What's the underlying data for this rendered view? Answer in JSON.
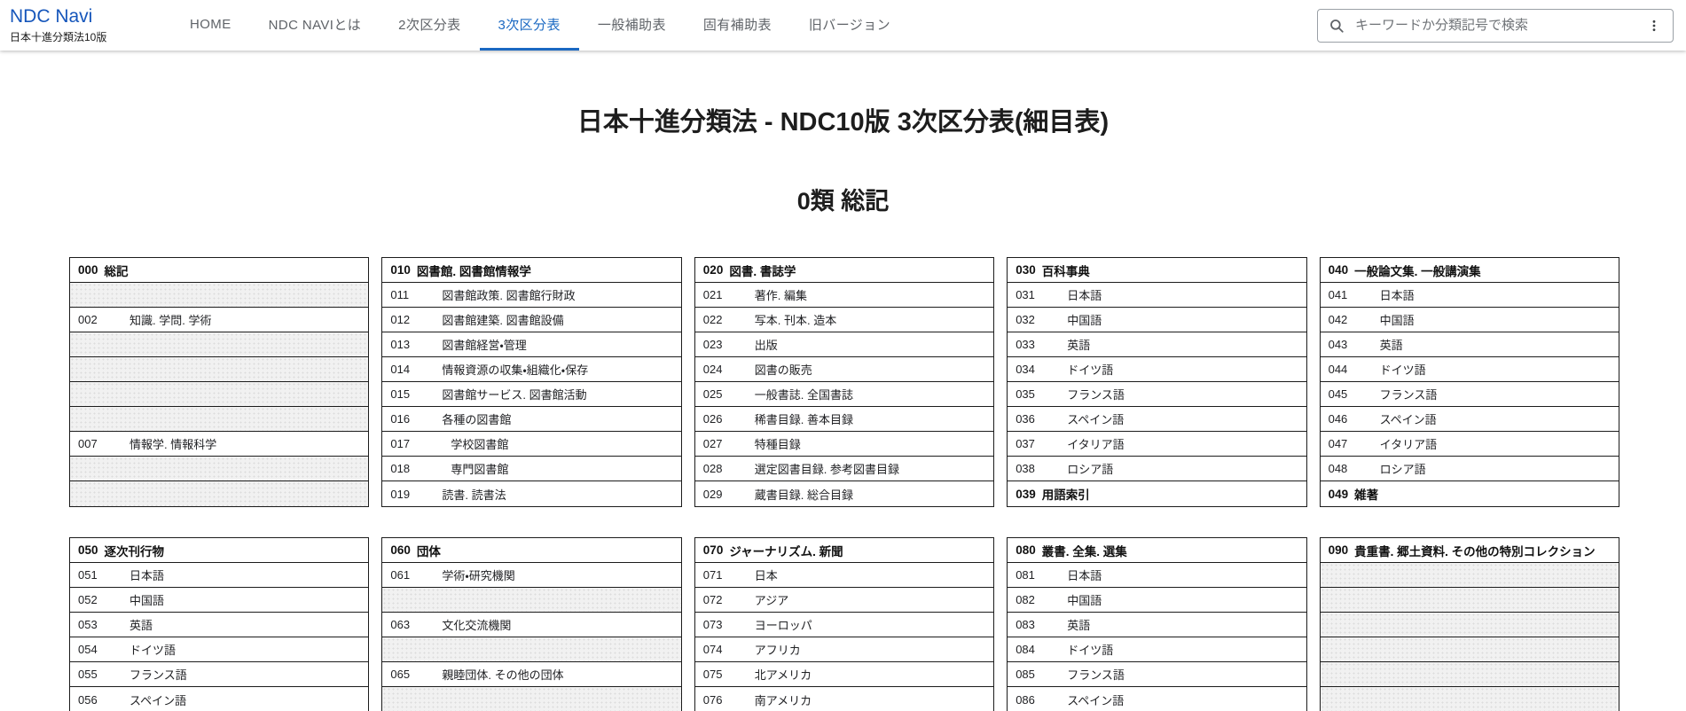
{
  "brand": {
    "title": "NDC Navi",
    "subtitle": "日本十進分類法10版"
  },
  "nav": {
    "items": [
      {
        "label": "HOME",
        "active": false
      },
      {
        "label": "NDC NAVIとは",
        "active": false
      },
      {
        "label": "2次区分表",
        "active": false
      },
      {
        "label": "3次区分表",
        "active": true
      },
      {
        "label": "一般補助表",
        "active": false
      },
      {
        "label": "固有補助表",
        "active": false
      },
      {
        "label": "旧バージョン",
        "active": false
      }
    ]
  },
  "search": {
    "placeholder": "キーワードか分類記号で検索",
    "value": "",
    "magnifier_icon": "search-icon",
    "menu_icon": "kebab-menu-icon"
  },
  "page": {
    "title": "日本十進分類法 - NDC10版 3次区分表(細目表)",
    "section_heading": "0類 総記"
  },
  "colors": {
    "brand_blue": "#1656bb",
    "active_tab_blue": "#1a68c2",
    "nav_gray": "#5f6368",
    "table_border": "#1c1c1c",
    "empty_row_bg": "#f1f1f1"
  },
  "sections": [
    {
      "tables": [
        {
          "code": "000",
          "title": "総記",
          "rows": [
            {
              "empty": true
            },
            {
              "code": "002",
              "label": "知識. 学問. 学術"
            },
            {
              "empty": true
            },
            {
              "empty": true
            },
            {
              "empty": true
            },
            {
              "empty": true
            },
            {
              "code": "007",
              "label": "情報学. 情報科学"
            },
            {
              "empty": true
            },
            {
              "empty": true
            }
          ]
        },
        {
          "code": "010",
          "title": "図書館. 図書館情報学",
          "rows": [
            {
              "code": "011",
              "label": "図書館政策. 図書館行財政"
            },
            {
              "code": "012",
              "label": "図書館建築. 図書館設備"
            },
            {
              "code": "013",
              "label": "図書館経営・管理"
            },
            {
              "code": "014",
              "label": "情報資源の収集・組織化・保存"
            },
            {
              "code": "015",
              "label": "図書館サービス. 図書館活動"
            },
            {
              "code": "016",
              "label": "各種の図書館"
            },
            {
              "code": "017",
              "label": "学校図書館",
              "indent": true
            },
            {
              "code": "018",
              "label": "専門図書館",
              "indent": true
            },
            {
              "code": "019",
              "label": "読書. 読書法"
            }
          ]
        },
        {
          "code": "020",
          "title": "図書. 書誌学",
          "rows": [
            {
              "code": "021",
              "label": "著作. 編集"
            },
            {
              "code": "022",
              "label": "写本. 刊本. 造本"
            },
            {
              "code": "023",
              "label": "出版"
            },
            {
              "code": "024",
              "label": "図書の販売"
            },
            {
              "code": "025",
              "label": "一般書誌. 全国書誌"
            },
            {
              "code": "026",
              "label": "稀書目録. 善本目録"
            },
            {
              "code": "027",
              "label": "特種目録"
            },
            {
              "code": "028",
              "label": "選定図書目録. 参考図書目録"
            },
            {
              "code": "029",
              "label": "蔵書目録. 総合目録"
            }
          ]
        },
        {
          "code": "030",
          "title": "百科事典",
          "rows": [
            {
              "code": "031",
              "label": "日本語"
            },
            {
              "code": "032",
              "label": "中国語"
            },
            {
              "code": "033",
              "label": "英語"
            },
            {
              "code": "034",
              "label": "ドイツ語"
            },
            {
              "code": "035",
              "label": "フランス語"
            },
            {
              "code": "036",
              "label": "スペイン語"
            },
            {
              "code": "037",
              "label": "イタリア語"
            },
            {
              "code": "038",
              "label": "ロシア語"
            },
            {
              "code": "039",
              "label": "用語索引",
              "bold": true
            }
          ]
        },
        {
          "code": "040",
          "title": "一般論文集. 一般講演集",
          "rows": [
            {
              "code": "041",
              "label": "日本語"
            },
            {
              "code": "042",
              "label": "中国語"
            },
            {
              "code": "043",
              "label": "英語"
            },
            {
              "code": "044",
              "label": "ドイツ語"
            },
            {
              "code": "045",
              "label": "フランス語"
            },
            {
              "code": "046",
              "label": "スペイン語"
            },
            {
              "code": "047",
              "label": "イタリア語"
            },
            {
              "code": "048",
              "label": "ロシア語"
            },
            {
              "code": "049",
              "label": "雑著",
              "bold": true
            }
          ]
        }
      ]
    },
    {
      "tables": [
        {
          "code": "050",
          "title": "逐次刊行物",
          "rows": [
            {
              "code": "051",
              "label": "日本語"
            },
            {
              "code": "052",
              "label": "中国語"
            },
            {
              "code": "053",
              "label": "英語"
            },
            {
              "code": "054",
              "label": "ドイツ語"
            },
            {
              "code": "055",
              "label": "フランス語"
            },
            {
              "code": "056",
              "label": "スペイン語"
            }
          ]
        },
        {
          "code": "060",
          "title": "団体",
          "rows": [
            {
              "code": "061",
              "label": "学術・研究機関"
            },
            {
              "empty": true
            },
            {
              "code": "063",
              "label": "文化交流機関"
            },
            {
              "empty": true
            },
            {
              "code": "065",
              "label": "親睦団体. その他の団体"
            },
            {
              "empty": true
            }
          ]
        },
        {
          "code": "070",
          "title": "ジャーナリズム. 新聞",
          "rows": [
            {
              "code": "071",
              "label": "日本"
            },
            {
              "code": "072",
              "label": "アジア"
            },
            {
              "code": "073",
              "label": "ヨーロッパ"
            },
            {
              "code": "074",
              "label": "アフリカ"
            },
            {
              "code": "075",
              "label": "北アメリカ"
            },
            {
              "code": "076",
              "label": "南アメリカ"
            }
          ]
        },
        {
          "code": "080",
          "title": "叢書. 全集. 選集",
          "rows": [
            {
              "code": "081",
              "label": "日本語"
            },
            {
              "code": "082",
              "label": "中国語"
            },
            {
              "code": "083",
              "label": "英語"
            },
            {
              "code": "084",
              "label": "ドイツ語"
            },
            {
              "code": "085",
              "label": "フランス語"
            },
            {
              "code": "086",
              "label": "スペイン語"
            }
          ]
        },
        {
          "code": "090",
          "title": "貴重書. 郷土資料. その他の特別コレクション",
          "rows": [
            {
              "empty": true
            },
            {
              "empty": true
            },
            {
              "empty": true
            },
            {
              "empty": true
            },
            {
              "empty": true
            },
            {
              "empty": true
            }
          ]
        }
      ]
    }
  ]
}
